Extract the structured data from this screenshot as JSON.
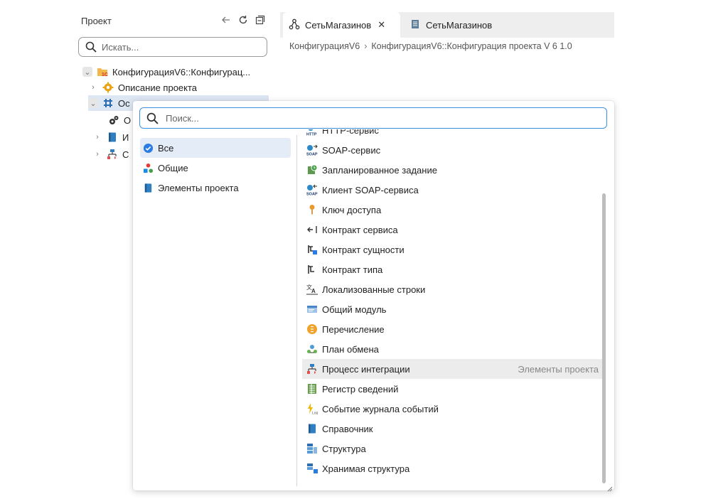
{
  "project_panel": {
    "title": "Проект",
    "search_placeholder": "Искать...",
    "tree": [
      {
        "label": "КонфигурацияV6::Конфигурац...",
        "icon": "config-1c-icon",
        "expanded": true
      },
      {
        "label": "Описание проекта",
        "icon": "gear-icon"
      },
      {
        "label": "Ос",
        "icon": "grid-icon",
        "expanded": true
      },
      {
        "label": "О",
        "icon": "gears-icon"
      },
      {
        "label": "И",
        "icon": "book-icon"
      },
      {
        "label": "С",
        "icon": "integration-icon"
      }
    ]
  },
  "tabs": [
    {
      "label": "СетьМагазинов",
      "icon": "network-icon",
      "active": true,
      "close": "✕"
    },
    {
      "label": "СетьМагазинов",
      "icon": "document-icon",
      "active": false
    }
  ],
  "breadcrumb": [
    "КонфигурацияV6",
    "КонфигурацияV6::Конфигурация проекта V 6 1.0"
  ],
  "popup": {
    "search_placeholder": "Поиск...",
    "categories": [
      {
        "label": "Все",
        "icon": "check-circle-icon",
        "selected": true
      },
      {
        "label": "Общие",
        "icon": "shapes-icon"
      },
      {
        "label": "Элементы проекта",
        "icon": "book-icon"
      }
    ],
    "items": [
      {
        "label": "HTTP-сервис",
        "icon": "http-icon"
      },
      {
        "label": "SOAP-сервис",
        "icon": "soap-icon"
      },
      {
        "label": "Запланированное задание",
        "icon": "scheduled-task-icon"
      },
      {
        "label": "Клиент SOAP-сервиса",
        "icon": "soap-client-icon"
      },
      {
        "label": "Ключ доступа",
        "icon": "key-icon"
      },
      {
        "label": "Контракт сервиса",
        "icon": "service-contract-icon"
      },
      {
        "label": "Контракт сущности",
        "icon": "entity-contract-icon"
      },
      {
        "label": "Контракт типа",
        "icon": "type-contract-icon"
      },
      {
        "label": "Локализованные строки",
        "icon": "localization-icon"
      },
      {
        "label": "Общий модуль",
        "icon": "module-icon"
      },
      {
        "label": "Перечисление",
        "icon": "enum-icon"
      },
      {
        "label": "План обмена",
        "icon": "exchange-plan-icon"
      },
      {
        "label": "Процесс интеграции",
        "icon": "integration-process-icon",
        "category": "Элементы проекта",
        "highlighted": true
      },
      {
        "label": "Регистр сведений",
        "icon": "register-icon"
      },
      {
        "label": "Событие журнала событий",
        "icon": "log-event-icon"
      },
      {
        "label": "Справочник",
        "icon": "catalog-icon"
      },
      {
        "label": "Структура",
        "icon": "structure-icon"
      },
      {
        "label": "Хранимая структура",
        "icon": "stored-structure-icon"
      }
    ]
  }
}
